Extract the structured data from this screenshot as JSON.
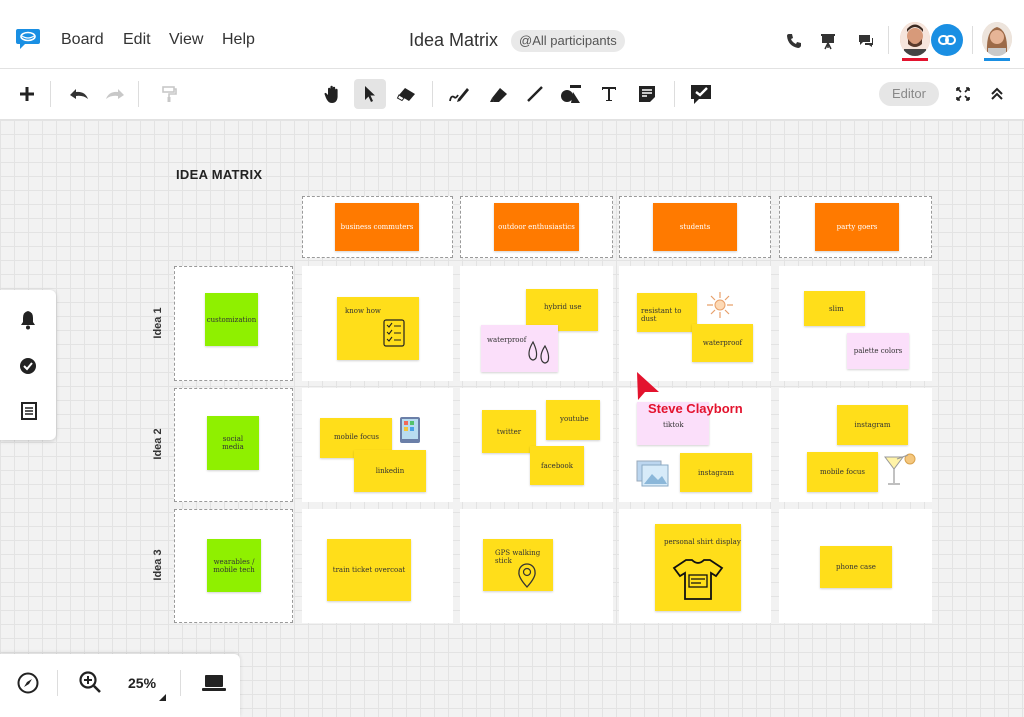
{
  "app": {
    "menu": [
      "Board",
      "Edit",
      "View",
      "Help"
    ],
    "title": "Idea Matrix",
    "participants_chip": "@All participants"
  },
  "toolbar": {
    "editor_label": "Editor",
    "zoom": "25%"
  },
  "board": {
    "title": "IDEA MATRIX",
    "columns": [
      "business commuters",
      "outdoor enthusiastics",
      "students",
      "party goers"
    ],
    "rows": [
      {
        "label": "Idea 1",
        "topic": "customization"
      },
      {
        "label": "Idea 2",
        "topic": "social media"
      },
      {
        "label": "Idea 3",
        "topic": "wearables / mobile tech"
      }
    ],
    "notes": {
      "r1c1": [
        "know how"
      ],
      "r1c2": [
        "hybrid use",
        "waterproof"
      ],
      "r1c3": [
        "resistant to dust",
        "waterproof"
      ],
      "r1c4": [
        "slim",
        "palette colors"
      ],
      "r2c1": [
        "mobile focus",
        "linkedin"
      ],
      "r2c2": [
        "twitter",
        "youtube",
        "facebook"
      ],
      "r2c3": [
        "tiktok",
        "instagram"
      ],
      "r2c4": [
        "instagram",
        "mobile focus"
      ],
      "r3c1": [
        "train ticket overcoat"
      ],
      "r3c2": [
        "GPS walking stick"
      ],
      "r3c3": [
        "personal shirt display"
      ],
      "r3c4": [
        "phone case"
      ]
    }
  },
  "cursor": {
    "name": "Steve Clayborn",
    "color": "#e3132e"
  },
  "colors": {
    "accent": "#1a8fe3",
    "orange": "#ff7a00",
    "green": "#8ff000",
    "yellow": "#ffde1a",
    "pink": "#fbdffa"
  }
}
